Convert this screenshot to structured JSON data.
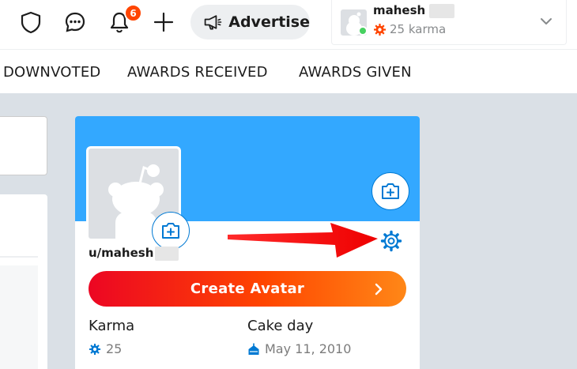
{
  "header": {
    "notification_count": "6",
    "advertise_label": "Advertise",
    "username": "mahesh",
    "karma": "25 karma"
  },
  "tabs": [
    "DOWNVOTED",
    "AWARDS RECEIVED",
    "AWARDS GIVEN"
  ],
  "profile": {
    "username": "u/mahesh",
    "create_avatar_label": "Create Avatar",
    "karma_label": "Karma",
    "karma_value": "25",
    "cake_day_label": "Cake day",
    "cake_day_value": "May 11, 2010"
  },
  "colors": {
    "brand_orange": "#ff4500",
    "banner_blue": "#33a8ff",
    "link_blue": "#0079d3",
    "annotation_red": "#ff0000",
    "online_green": "#46d160"
  },
  "icons": [
    "shield-icon",
    "chat-icon",
    "bell-icon",
    "plus-icon",
    "megaphone-icon",
    "chevron-down-icon",
    "karma-icon",
    "camera-add-icon",
    "gear-icon",
    "chevron-right-icon",
    "cake-icon"
  ]
}
